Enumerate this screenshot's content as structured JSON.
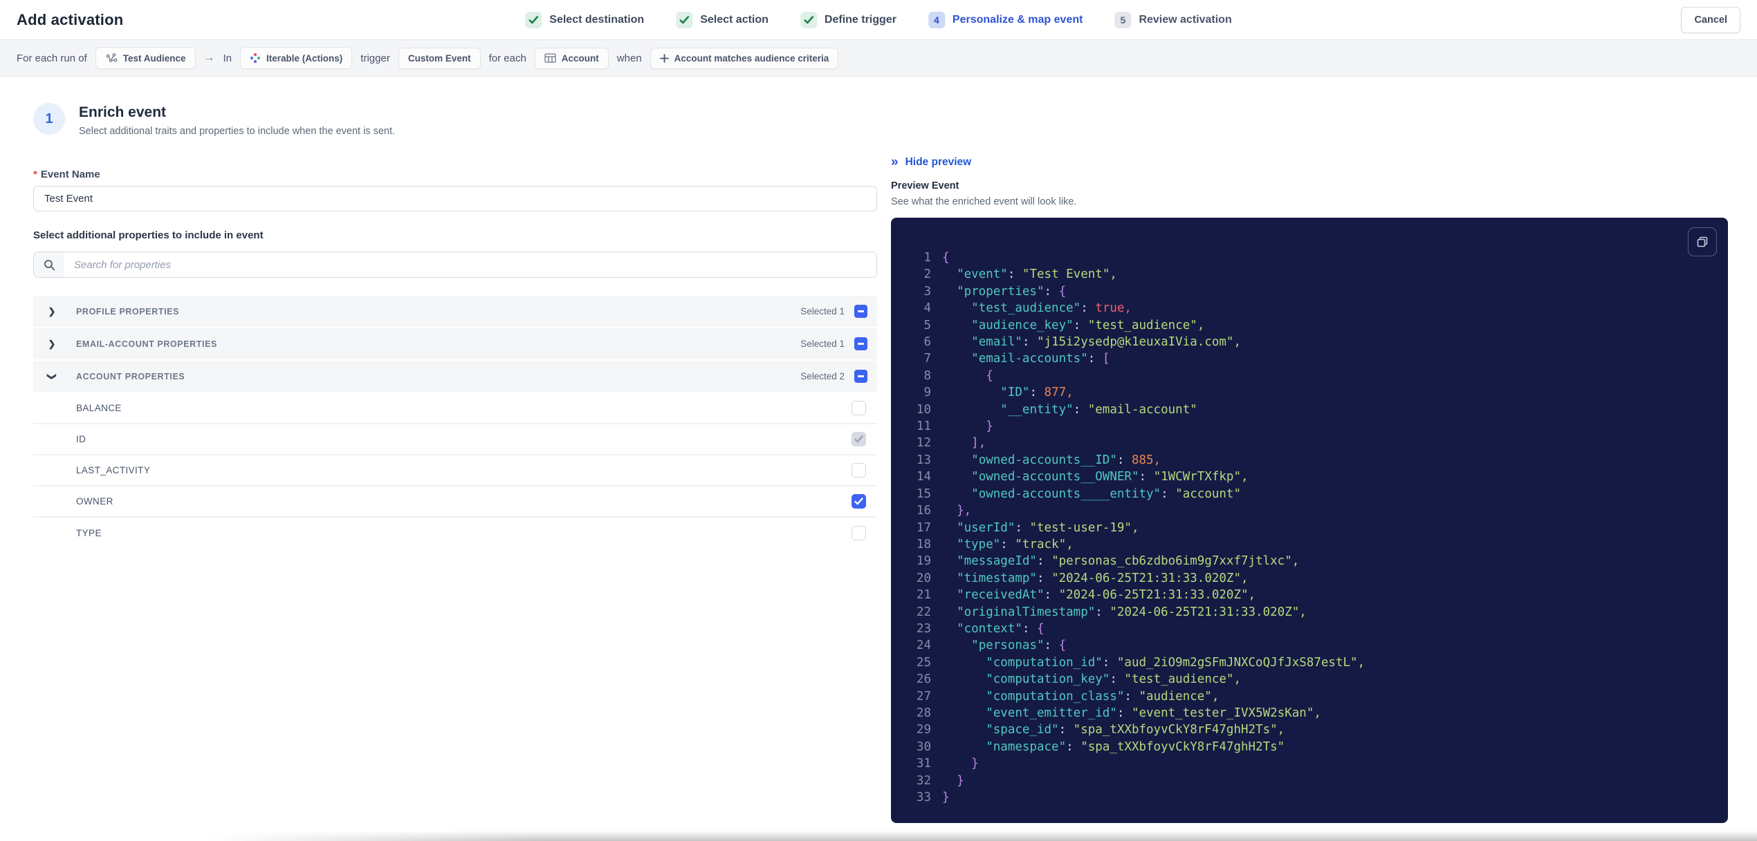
{
  "header": {
    "title": "Add activation",
    "cancel_label": "Cancel",
    "steps": [
      {
        "label": "Select destination",
        "state": "done",
        "icon": "check-icon"
      },
      {
        "label": "Select action",
        "state": "done",
        "icon": "check-icon"
      },
      {
        "label": "Define trigger",
        "state": "done",
        "icon": "check-icon"
      },
      {
        "label": "Personalize & map event",
        "state": "active",
        "number": "4"
      },
      {
        "label": "Review activation",
        "state": "upcoming",
        "number": "5"
      }
    ]
  },
  "trigger_bar": {
    "segments": [
      {
        "type": "text",
        "label": "For each run of"
      },
      {
        "type": "pill",
        "label": "Test Audience",
        "icon": "audience-icon",
        "name": "pill-test-audience"
      },
      {
        "type": "arrow",
        "label": "→"
      },
      {
        "type": "text",
        "label": "In"
      },
      {
        "type": "pill",
        "label": "Iterable (Actions)",
        "icon": "iterable-icon",
        "name": "pill-iterable-actions"
      },
      {
        "type": "text",
        "label": "trigger"
      },
      {
        "type": "pill",
        "label": "Custom Event",
        "name": "pill-custom-event"
      },
      {
        "type": "text",
        "label": "for each"
      },
      {
        "type": "pill",
        "label": "Account",
        "icon": "table-icon",
        "name": "pill-account"
      },
      {
        "type": "text",
        "label": "when"
      },
      {
        "type": "pill",
        "label": "Account matches audience criteria",
        "icon": "plus-icon",
        "name": "pill-account-matches-audience-criteria"
      }
    ]
  },
  "enrich": {
    "step_number": "1",
    "title": "Enrich event",
    "subtitle": "Select additional traits and properties to include when the event is sent.",
    "event_name_label": "Event Name",
    "event_name_value": "Test Event",
    "properties_label": "Select additional properties to include in event",
    "search_placeholder": "Search for properties",
    "groups": [
      {
        "label": "PROFILE PROPERTIES",
        "selected_text": "Selected 1",
        "expanded": false,
        "items": []
      },
      {
        "label": "EMAIL-ACCOUNT PROPERTIES",
        "selected_text": "Selected 1",
        "expanded": false,
        "items": []
      },
      {
        "label": "ACCOUNT PROPERTIES",
        "selected_text": "Selected 2",
        "expanded": true,
        "items": [
          {
            "label": "BALANCE",
            "checked": false,
            "disabled": false
          },
          {
            "label": "ID",
            "checked": true,
            "disabled": true
          },
          {
            "label": "LAST_ACTIVITY",
            "checked": false,
            "disabled": false
          },
          {
            "label": "OWNER",
            "checked": true,
            "disabled": false
          },
          {
            "label": "TYPE",
            "checked": false,
            "disabled": false
          }
        ]
      }
    ]
  },
  "preview": {
    "hide_label": "Hide preview",
    "title": "Preview Event",
    "subtitle": "See what the enriched event will look like.",
    "copy_icon": "copy-icon",
    "code_lines": [
      {
        "n": 1,
        "ind": 0,
        "tokens": [
          [
            "pu",
            "{"
          ]
        ]
      },
      {
        "n": 2,
        "ind": 2,
        "tokens": [
          [
            "k",
            "\"event\""
          ],
          [
            "c",
            ": "
          ],
          [
            "s",
            "\"Test Event\","
          ]
        ]
      },
      {
        "n": 3,
        "ind": 2,
        "tokens": [
          [
            "k",
            "\"properties\""
          ],
          [
            "c",
            ": "
          ],
          [
            "pu",
            "{"
          ]
        ]
      },
      {
        "n": 4,
        "ind": 4,
        "tokens": [
          [
            "k",
            "\"test_audience\""
          ],
          [
            "c",
            ": "
          ],
          [
            "b",
            "true,"
          ]
        ]
      },
      {
        "n": 5,
        "ind": 4,
        "tokens": [
          [
            "k",
            "\"audience_key\""
          ],
          [
            "c",
            ": "
          ],
          [
            "s",
            "\"test_audience\","
          ]
        ]
      },
      {
        "n": 6,
        "ind": 4,
        "tokens": [
          [
            "k",
            "\"email\""
          ],
          [
            "c",
            ": "
          ],
          [
            "s",
            "\"j15i2ysedp@k1euxaIVia.com\","
          ]
        ]
      },
      {
        "n": 7,
        "ind": 4,
        "tokens": [
          [
            "k",
            "\"email-accounts\""
          ],
          [
            "c",
            ": "
          ],
          [
            "pu",
            "["
          ]
        ]
      },
      {
        "n": 8,
        "ind": 6,
        "tokens": [
          [
            "pu",
            "{"
          ]
        ]
      },
      {
        "n": 9,
        "ind": 8,
        "tokens": [
          [
            "k",
            "\"ID\""
          ],
          [
            "c",
            ": "
          ],
          [
            "n",
            "877,"
          ]
        ]
      },
      {
        "n": 10,
        "ind": 8,
        "tokens": [
          [
            "k",
            "\"__entity\""
          ],
          [
            "c",
            ": "
          ],
          [
            "s",
            "\"email-account\""
          ]
        ]
      },
      {
        "n": 11,
        "ind": 6,
        "tokens": [
          [
            "pu",
            "}"
          ]
        ]
      },
      {
        "n": 12,
        "ind": 4,
        "tokens": [
          [
            "pu",
            "],"
          ]
        ]
      },
      {
        "n": 13,
        "ind": 4,
        "tokens": [
          [
            "k",
            "\"owned-accounts__ID\""
          ],
          [
            "c",
            ": "
          ],
          [
            "n",
            "885,"
          ]
        ]
      },
      {
        "n": 14,
        "ind": 4,
        "tokens": [
          [
            "k",
            "\"owned-accounts__OWNER\""
          ],
          [
            "c",
            ": "
          ],
          [
            "s",
            "\"1WCWrTXfkp\","
          ]
        ]
      },
      {
        "n": 15,
        "ind": 4,
        "tokens": [
          [
            "k",
            "\"owned-accounts____entity\""
          ],
          [
            "c",
            ": "
          ],
          [
            "s",
            "\"account\""
          ]
        ]
      },
      {
        "n": 16,
        "ind": 2,
        "tokens": [
          [
            "pu",
            "},"
          ]
        ]
      },
      {
        "n": 17,
        "ind": 2,
        "tokens": [
          [
            "k",
            "\"userId\""
          ],
          [
            "c",
            ": "
          ],
          [
            "s",
            "\"test-user-19\","
          ]
        ]
      },
      {
        "n": 18,
        "ind": 2,
        "tokens": [
          [
            "k",
            "\"type\""
          ],
          [
            "c",
            ": "
          ],
          [
            "s",
            "\"track\","
          ]
        ]
      },
      {
        "n": 19,
        "ind": 2,
        "tokens": [
          [
            "k",
            "\"messageId\""
          ],
          [
            "c",
            ": "
          ],
          [
            "s",
            "\"personas_cb6zdbo6im9g7xxf7jtlxc\","
          ]
        ]
      },
      {
        "n": 20,
        "ind": 2,
        "tokens": [
          [
            "k",
            "\"timestamp\""
          ],
          [
            "c",
            ": "
          ],
          [
            "s",
            "\"2024-06-25T21:31:33.020Z\","
          ]
        ]
      },
      {
        "n": 21,
        "ind": 2,
        "tokens": [
          [
            "k",
            "\"receivedAt\""
          ],
          [
            "c",
            ": "
          ],
          [
            "s",
            "\"2024-06-25T21:31:33.020Z\","
          ]
        ]
      },
      {
        "n": 22,
        "ind": 2,
        "tokens": [
          [
            "k",
            "\"originalTimestamp\""
          ],
          [
            "c",
            ": "
          ],
          [
            "s",
            "\"2024-06-25T21:31:33.020Z\","
          ]
        ]
      },
      {
        "n": 23,
        "ind": 2,
        "tokens": [
          [
            "k",
            "\"context\""
          ],
          [
            "c",
            ": "
          ],
          [
            "pu",
            "{"
          ]
        ]
      },
      {
        "n": 24,
        "ind": 4,
        "tokens": [
          [
            "k",
            "\"personas\""
          ],
          [
            "c",
            ": "
          ],
          [
            "pu",
            "{"
          ]
        ]
      },
      {
        "n": 25,
        "ind": 6,
        "tokens": [
          [
            "k",
            "\"computation_id\""
          ],
          [
            "c",
            ": "
          ],
          [
            "s",
            "\"aud_2iO9m2gSFmJNXCoQJfJxS87estL\","
          ]
        ]
      },
      {
        "n": 26,
        "ind": 6,
        "tokens": [
          [
            "k",
            "\"computation_key\""
          ],
          [
            "c",
            ": "
          ],
          [
            "s",
            "\"test_audience\","
          ]
        ]
      },
      {
        "n": 27,
        "ind": 6,
        "tokens": [
          [
            "k",
            "\"computation_class\""
          ],
          [
            "c",
            ": "
          ],
          [
            "s",
            "\"audience\","
          ]
        ]
      },
      {
        "n": 28,
        "ind": 6,
        "tokens": [
          [
            "k",
            "\"event_emitter_id\""
          ],
          [
            "c",
            ": "
          ],
          [
            "s",
            "\"event_tester_IVX5W2sKan\","
          ]
        ]
      },
      {
        "n": 29,
        "ind": 6,
        "tokens": [
          [
            "k",
            "\"space_id\""
          ],
          [
            "c",
            ": "
          ],
          [
            "s",
            "\"spa_tXXbfoyvCkY8rF47ghH2Ts\","
          ]
        ]
      },
      {
        "n": 30,
        "ind": 6,
        "tokens": [
          [
            "k",
            "\"namespace\""
          ],
          [
            "c",
            ": "
          ],
          [
            "s",
            "\"spa_tXXbfoyvCkY8rF47ghH2Ts\""
          ]
        ]
      },
      {
        "n": 31,
        "ind": 4,
        "tokens": [
          [
            "pu",
            "}"
          ]
        ]
      },
      {
        "n": 32,
        "ind": 2,
        "tokens": [
          [
            "pu",
            "}"
          ]
        ]
      },
      {
        "n": 33,
        "ind": 0,
        "tokens": [
          [
            "pu",
            "}"
          ]
        ]
      }
    ]
  },
  "colors": {
    "accent_blue": "#2d55d6",
    "checkbox_blue": "#3d63f2",
    "success_green": "#1d804a",
    "code_background": "#151a44",
    "code_key": "#4fc8c2",
    "code_string": "#b4da7d",
    "code_number": "#e8854e",
    "code_boolean": "#ef5e6e",
    "code_bracket": "#bd87e2"
  }
}
